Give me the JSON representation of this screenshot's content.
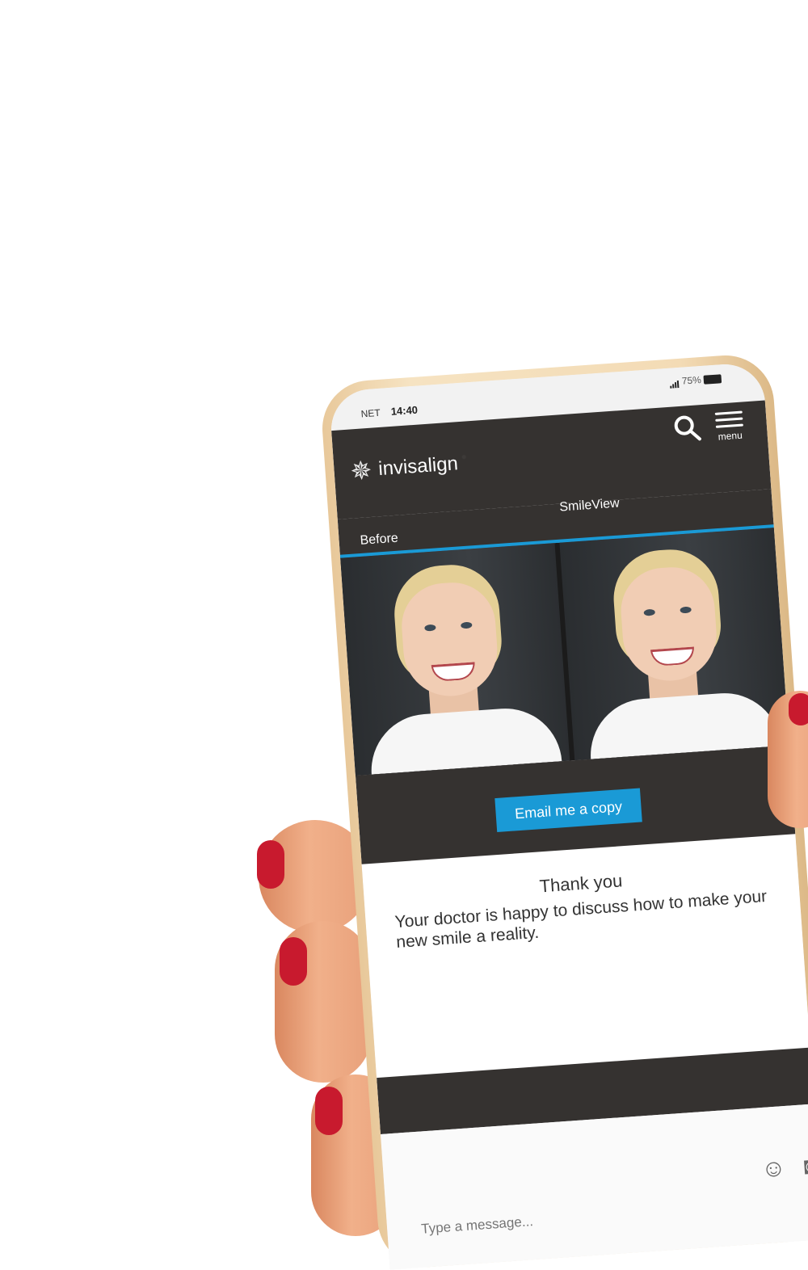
{
  "status": {
    "carrier": "NET",
    "time": "14:40",
    "battery": "75%"
  },
  "header": {
    "brand": "invisalign",
    "menu_label": "menu"
  },
  "tabs": {
    "before": "Before",
    "smileview": "SmileView"
  },
  "actions": {
    "email_label": "Email me a copy"
  },
  "thanks": {
    "title": "Thank you",
    "body": "Your doctor is happy to discuss how to make your new smile a reality."
  },
  "message": {
    "placeholder": "Type a message..."
  },
  "colors": {
    "accent": "#1a9ad6",
    "header_bg": "#353230",
    "nail": "#c81a2e"
  }
}
